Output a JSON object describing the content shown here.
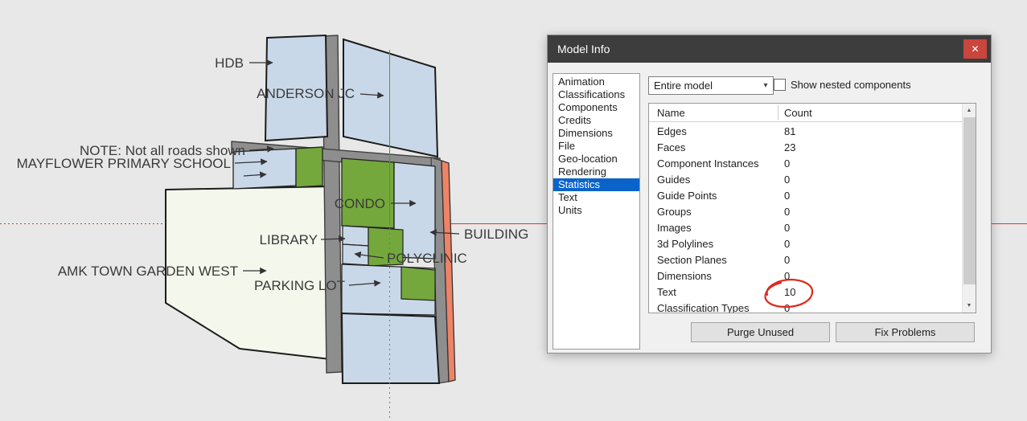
{
  "scene": {
    "labels": [
      "HDB",
      "ANDERSON JC",
      "NOTE: Not all roads shown",
      "MAYFLOWER PRIMARY SCHOOL",
      "CONDO",
      "LIBRARY",
      "BUILDING",
      "POLYCLINIC",
      "AMK TOWN GARDEN WEST",
      "PARKING LOT"
    ],
    "colors": {
      "face_blue": "#c9d8e8",
      "face_green": "#74a83c",
      "face_white": "#f3f7ec",
      "face_orange": "#ee8366",
      "road_gray": "#8e8e8e",
      "axis_red": "#d93a30",
      "axis_green": "#3c9e3c"
    }
  },
  "dialog": {
    "title": "Model Info",
    "icons": {
      "close": "✕",
      "chevron_down": "▾",
      "scroll_up": "▲",
      "scroll_down": "▼"
    },
    "scope_select": {
      "value": "Entire model"
    },
    "nested_checkbox": {
      "label": "Show nested components",
      "checked": false
    },
    "categories": [
      "Animation",
      "Classifications",
      "Components",
      "Credits",
      "Dimensions",
      "File",
      "Geo-location",
      "Rendering",
      "Statistics",
      "Text",
      "Units"
    ],
    "selected_category": "Statistics",
    "stats": {
      "columns": [
        "Name",
        "Count"
      ],
      "rows": [
        {
          "name": "Edges",
          "count": "81"
        },
        {
          "name": "Faces",
          "count": "23"
        },
        {
          "name": "Component Instances",
          "count": "0"
        },
        {
          "name": "Guides",
          "count": "0"
        },
        {
          "name": "Guide Points",
          "count": "0"
        },
        {
          "name": "Groups",
          "count": "0"
        },
        {
          "name": "Images",
          "count": "0"
        },
        {
          "name": "3d Polylines",
          "count": "0"
        },
        {
          "name": "Section Planes",
          "count": "0"
        },
        {
          "name": "Dimensions",
          "count": "0"
        },
        {
          "name": "Text",
          "count": "10"
        },
        {
          "name": "Classification Types",
          "count": "0"
        }
      ]
    },
    "buttons": {
      "purge": "Purge Unused",
      "fix": "Fix Problems"
    },
    "annotation": {
      "type": "hand-drawn-circle",
      "target": "Text count",
      "value": "10",
      "color": "#dd2b20"
    }
  }
}
